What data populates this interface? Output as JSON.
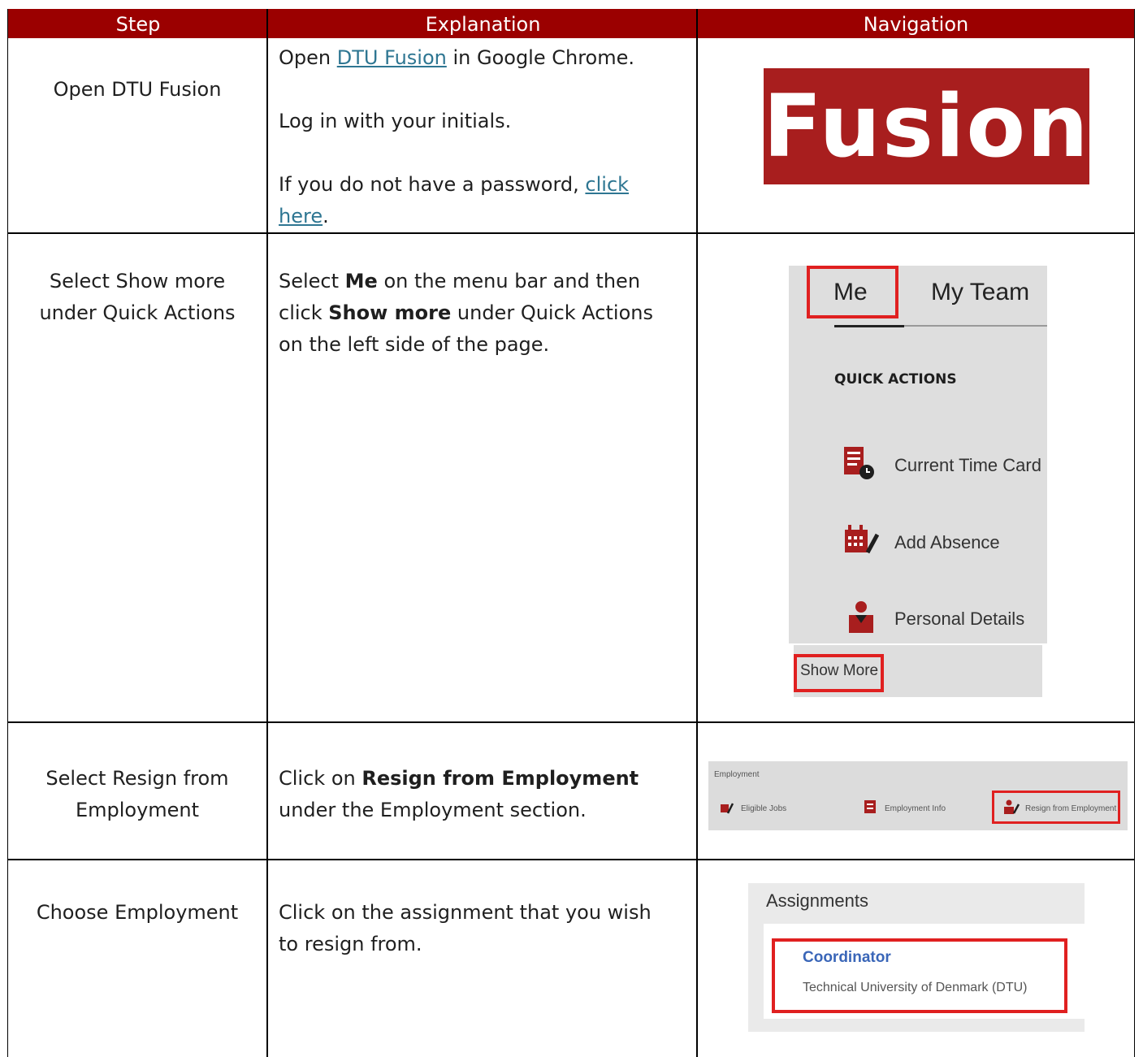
{
  "header": {
    "col1": "Step",
    "col2": "Explanation",
    "col3": "Navigation"
  },
  "rows": [
    {
      "step": "Open DTU Fusion",
      "explanation": {
        "p1_a": "Open ",
        "p1_link": "DTU Fusion",
        "p1_b": " in Google Chrome.",
        "p2": "Log in with your initials.",
        "p3_a": "If you do not have a password, ",
        "p3_link_1": "click",
        "p3_link_2": "here",
        "p3_b": "."
      },
      "logo": "Fusion"
    },
    {
      "step_l1": "Select Show more",
      "step_l2": "under Quick Actions",
      "explanation": {
        "a": "Select ",
        "b1": "Me",
        "c": " on the menu bar and then",
        "d": "click ",
        "b2": "Show more",
        "e": " under Quick Actions",
        "f": "on the left side of the page."
      },
      "panel": {
        "tab_me": "Me",
        "tab_team": "My Team",
        "title": "QUICK ACTIONS",
        "items": [
          "Current Time Card",
          "Add Absence",
          "Personal Details"
        ],
        "show_more": "Show More"
      }
    },
    {
      "step_l1": "Select Resign from",
      "step_l2": "Employment",
      "explanation": {
        "a": "Click on ",
        "b": "Resign from Employment",
        "c": "under the Employment section."
      },
      "panel": {
        "title": "Employment",
        "items": [
          "Eligible Jobs",
          "Employment Info",
          "Resign from Employment"
        ]
      }
    },
    {
      "step": "Choose Employment",
      "explanation": {
        "l1": "Click on the assignment that you wish",
        "l2": "to resign from."
      },
      "panel": {
        "title": "Assignments",
        "role": "Coordinator",
        "org": "Technical University of Denmark (DTU)"
      }
    }
  ],
  "colors": {
    "header_bg": "#9b0000",
    "link": "#2e7692",
    "highlight": "#e02020",
    "accent_red": "#a81e1e"
  },
  "icons": [
    "time-card-icon",
    "calendar-edit-icon",
    "person-icon",
    "jobs-icon",
    "badge-icon",
    "resign-icon"
  ]
}
